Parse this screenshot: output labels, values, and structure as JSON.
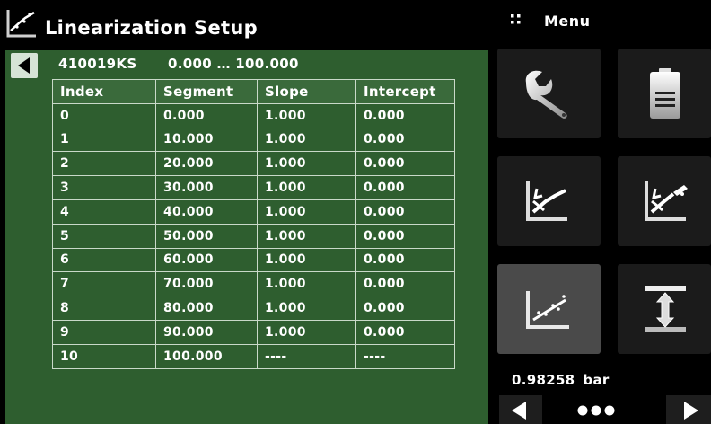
{
  "header": {
    "title": "Linearization Setup",
    "title_icon": "linearization-chart-icon",
    "menu_label": "Menu",
    "menu_icon": "grip-dots-icon"
  },
  "panel": {
    "sensor_id": "410019KS",
    "range": "0.000 … 100.000",
    "back_icon": "back-arrow-icon"
  },
  "table": {
    "headers": [
      "Index",
      "Segment",
      "Slope",
      "Intercept"
    ],
    "rows": [
      [
        "0",
        "0.000",
        "1.000",
        "0.000"
      ],
      [
        "1",
        "10.000",
        "1.000",
        "0.000"
      ],
      [
        "2",
        "20.000",
        "1.000",
        "0.000"
      ],
      [
        "3",
        "30.000",
        "1.000",
        "0.000"
      ],
      [
        "4",
        "40.000",
        "1.000",
        "0.000"
      ],
      [
        "5",
        "50.000",
        "1.000",
        "0.000"
      ],
      [
        "6",
        "60.000",
        "1.000",
        "0.000"
      ],
      [
        "7",
        "70.000",
        "1.000",
        "0.000"
      ],
      [
        "8",
        "80.000",
        "1.000",
        "0.000"
      ],
      [
        "9",
        "90.000",
        "1.000",
        "0.000"
      ],
      [
        "10",
        "100.000",
        "----",
        "----"
      ]
    ]
  },
  "tiles": [
    {
      "icon": "wrench-icon"
    },
    {
      "icon": "document-icon"
    },
    {
      "icon": "linearization-icon"
    },
    {
      "icon": "linearization-edit-icon"
    },
    {
      "icon": "linearization-points-icon",
      "selected": true
    },
    {
      "icon": "span-icon"
    }
  ],
  "reading": {
    "value": "0.98258",
    "unit": "bar"
  },
  "pager": {
    "prev_icon": "left-arrow-icon",
    "next_icon": "right-arrow-icon",
    "dots_icon": "page-dots-icon",
    "page_count": 3
  },
  "colors": {
    "panel_green": "#2e5e2f",
    "tile_dark": "#1b1b1b",
    "tile_selected": "#4a4a4a",
    "background": "#000000"
  }
}
